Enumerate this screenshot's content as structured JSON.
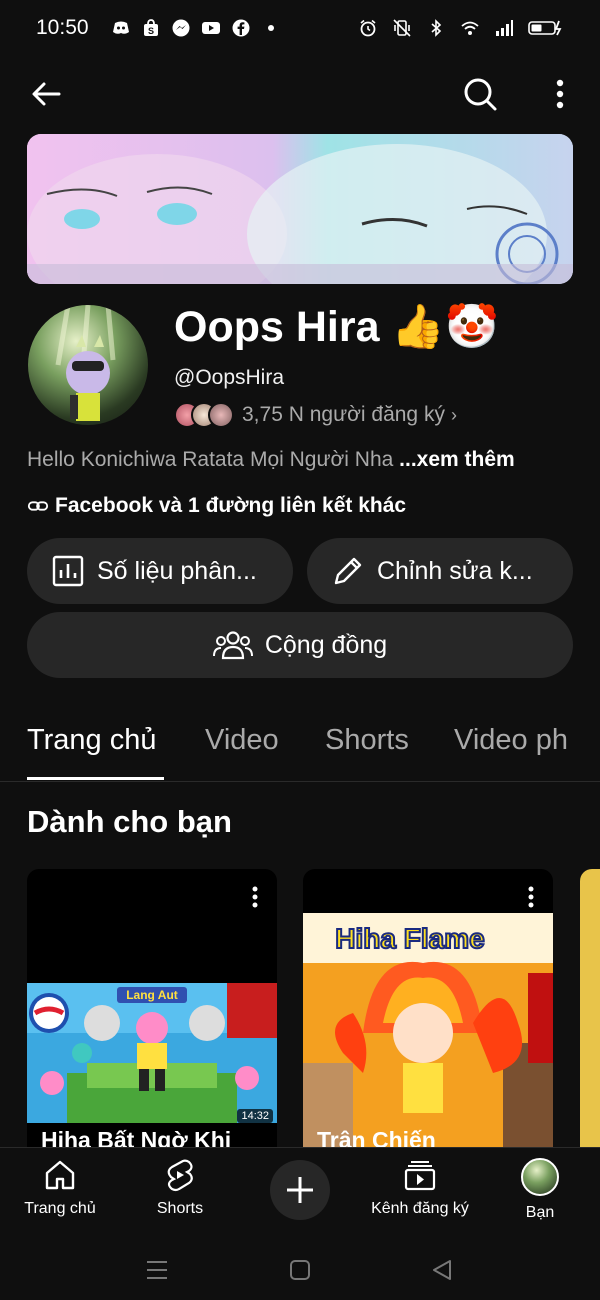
{
  "status_bar": {
    "time": "10:50",
    "left_icons": [
      "discord-icon",
      "shopee-icon",
      "messenger-icon",
      "youtube-icon",
      "facebook-icon",
      "dot-icon"
    ],
    "right_icons": [
      "alarm-icon",
      "vibrate-icon",
      "bluetooth-icon",
      "wifi-icon",
      "signal-icon",
      "battery-icon"
    ]
  },
  "channel": {
    "name": "Oops Hira 👍🤡",
    "handle": "@OopsHira",
    "subscribers": "3,75 N người đăng ký",
    "description": "Hello Konichiwa Ratata Mọi Người Nha",
    "description_more": "...xem thêm",
    "links": "Facebook và 1 đường liên kết khác"
  },
  "actions": {
    "analytics": "Số liệu phân...",
    "edit": "Chỉnh sửa k...",
    "community": "Cộng đồng"
  },
  "tabs": [
    "Trang chủ",
    "Video",
    "Shorts",
    "Video ph"
  ],
  "active_tab": "Trang chủ",
  "section_title": "Dành cho bạn",
  "cards": [
    {
      "title": "Hiha Bất Ngờ Khi",
      "duration": "14:32",
      "thumb_text": "Lang Aut"
    },
    {
      "title": "Trận Chiến",
      "thumb_text": "Hiha Flame"
    }
  ],
  "bottom_nav": {
    "home": "Trang chủ",
    "shorts": "Shorts",
    "subscriptions": "Kênh đăng ký",
    "you": "Bạn"
  },
  "colors": {
    "background": "#0f0f0f",
    "surface": "#272727",
    "text_primary": "#f1f1f1",
    "text_secondary": "#aaaaaa"
  }
}
